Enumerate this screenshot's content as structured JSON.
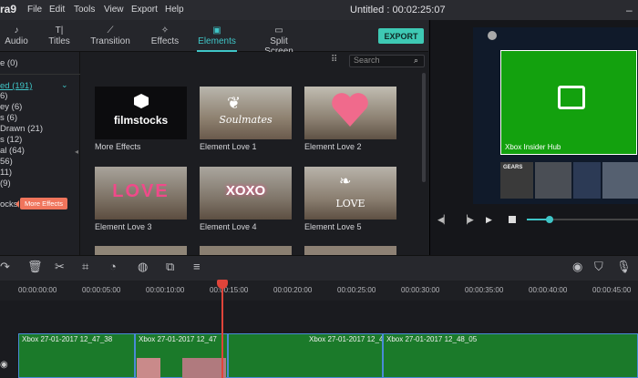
{
  "app": {
    "logo": "ra9",
    "project_title": "Untitled : 00:02:25:07",
    "menu": [
      "File",
      "Edit",
      "Tools",
      "View",
      "Export",
      "Help"
    ]
  },
  "tabs": [
    {
      "label": "Audio",
      "icon": "music-note-icon"
    },
    {
      "label": "Titles",
      "icon": "titles-icon"
    },
    {
      "label": "Transition",
      "icon": "transition-icon"
    },
    {
      "label": "Effects",
      "icon": "effects-icon"
    },
    {
      "label": "Elements",
      "icon": "image-icon",
      "active": true
    },
    {
      "label": "Split Screen",
      "icon": "split-screen-icon"
    }
  ],
  "export_label": "EXPORT",
  "sidebar": {
    "items": [
      "e (0)",
      "ed (191)",
      "6)",
      "ey (6)",
      "s (6)",
      "Drawn (21)",
      "s (12)",
      "al (64)",
      "56)",
      "11)",
      "(9)",
      "ocks"
    ],
    "tooltip": "More Effects"
  },
  "search": {
    "placeholder": "Search"
  },
  "elements": [
    {
      "label": "More Effects",
      "art": "filmstocks"
    },
    {
      "label": "Element Love 1",
      "art": "soulmates"
    },
    {
      "label": "Element Love 2",
      "art": "heart"
    },
    {
      "label": "Element Love 3",
      "art": "love"
    },
    {
      "label": "Element Love 4",
      "art": "xoxo"
    },
    {
      "label": "Element Love 5",
      "art": "love5"
    }
  ],
  "filmstocks_text": "filmstocks",
  "soulmates_text": "Soulmates",
  "love_text": "LOVE",
  "xoxo_text": "XOXO",
  "preview": {
    "tile_label": "Xbox Insider Hub",
    "gears_text": "GEARS"
  },
  "timecodes": [
    "00:00:00:00",
    "00:00:05:00",
    "00:00:10:00",
    "00:00:15:00",
    "00:00:20:00",
    "00:00:25:00",
    "00:00:30:00",
    "00:00:35:00",
    "00:00:40:00",
    "00:00:45:00"
  ],
  "clips": [
    {
      "label": "Xbox 27-01-2017 12_47_38"
    },
    {
      "label": "Xbox 27-01-2017 12_47"
    },
    {
      "label": "Xbox 27-01-2017 12_4"
    },
    {
      "label": "Xbox 27-01-2017 12_48_05"
    }
  ],
  "colors": {
    "accent": "#3fc5c7",
    "export": "#3ec9b4",
    "playhead": "#e0443a",
    "tooltip": "#f0755c"
  }
}
